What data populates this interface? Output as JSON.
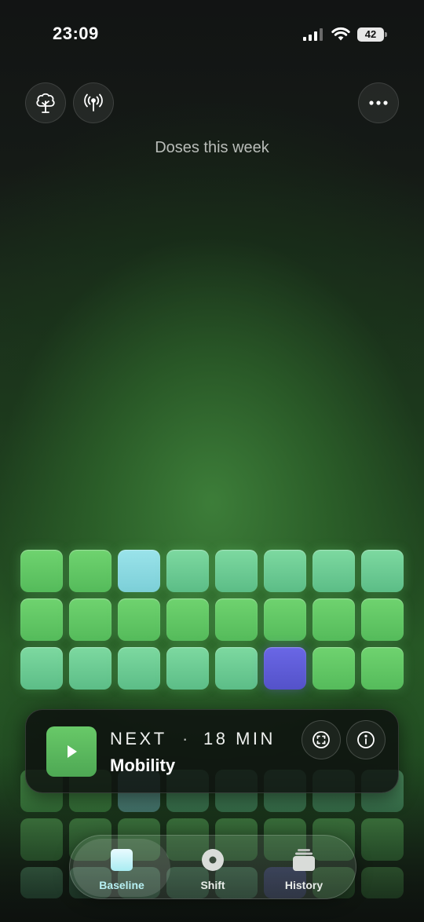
{
  "status_bar": {
    "time": "23:09",
    "battery": "42"
  },
  "header": {
    "title": "Doses this week"
  },
  "icons": {
    "tree": "tree-icon",
    "antenna": "antenna-icon",
    "more": "ellipsis-icon",
    "play": "play-icon",
    "focus": "focus-icon",
    "info": "info-icon"
  },
  "colors": {
    "green": "#5fc463",
    "teal": "#6ccb93",
    "sky": "#8ad9e1",
    "violet": "#5f5cd8"
  },
  "dose_grid": [
    [
      "green",
      "green",
      "sky",
      "teal",
      "teal",
      "teal",
      "teal",
      "teal"
    ],
    [
      "green",
      "green",
      "green",
      "green",
      "green",
      "green",
      "green",
      "green"
    ],
    [
      "teal",
      "teal",
      "teal",
      "teal",
      "teal",
      "violet",
      "green",
      "green"
    ]
  ],
  "next_session": {
    "label": "NEXT",
    "separator": "·",
    "duration": "18 MIN",
    "name": "Mobility"
  },
  "tabs": [
    {
      "label": "Baseline",
      "active": true
    },
    {
      "label": "Shift",
      "active": false
    },
    {
      "label": "History",
      "active": false
    }
  ]
}
